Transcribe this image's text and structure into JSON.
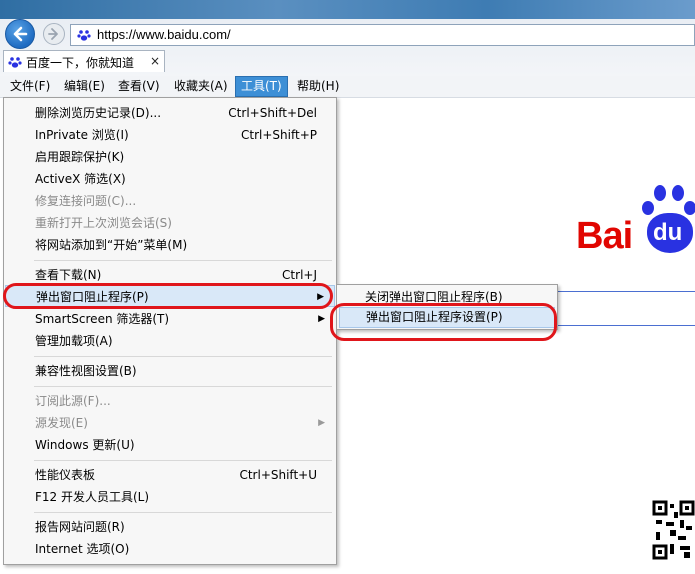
{
  "browser": {
    "url": "https://www.baidu.com/",
    "tab_title": "百度一下，你就知道",
    "tab_close": "×"
  },
  "menubar": [
    {
      "label": "文件(F)"
    },
    {
      "label": "编辑(E)"
    },
    {
      "label": "查看(V)"
    },
    {
      "label": "收藏夹(A)"
    },
    {
      "label": "工具(T)"
    },
    {
      "label": "帮助(H)"
    }
  ],
  "active_menu": "工具(T)",
  "tools_menu": {
    "items": [
      {
        "label": "删除浏览历史记录(D)...",
        "shortcut": "Ctrl+Shift+Del"
      },
      {
        "label": "InPrivate 浏览(I)",
        "shortcut": "Ctrl+Shift+P"
      },
      {
        "label": "启用跟踪保护(K)",
        "shortcut": ""
      },
      {
        "label": "ActiveX 筛选(X)",
        "shortcut": ""
      },
      {
        "label": "修复连接问题(C)...",
        "shortcut": "",
        "disabled": true
      },
      {
        "label": "重新打开上次浏览会话(S)",
        "shortcut": "",
        "disabled": true
      },
      {
        "label": "将网站添加到“开始”菜单(M)",
        "shortcut": ""
      },
      {
        "label": "查看下载(N)",
        "shortcut": "Ctrl+J"
      },
      {
        "label": "弹出窗口阻止程序(P)",
        "shortcut": "",
        "submenu": true
      },
      {
        "label": "SmartScreen 筛选器(T)",
        "shortcut": "",
        "submenu": true
      },
      {
        "label": "管理加载项(A)",
        "shortcut": ""
      },
      {
        "label": "兼容性视图设置(B)",
        "shortcut": ""
      },
      {
        "label": "订阅此源(F)...",
        "shortcut": "",
        "disabled": true
      },
      {
        "label": "源发现(E)",
        "shortcut": "",
        "disabled": true,
        "submenu": true
      },
      {
        "label": "Windows 更新(U)",
        "shortcut": ""
      },
      {
        "label": "性能仪表板",
        "shortcut": "Ctrl+Shift+U"
      },
      {
        "label": "F12 开发人员工具(L)",
        "shortcut": ""
      },
      {
        "label": "报告网站问题(R)",
        "shortcut": ""
      },
      {
        "label": "Internet 选项(O)",
        "shortcut": ""
      }
    ]
  },
  "popup_submenu": {
    "items": [
      {
        "label": "关闭弹出窗口阻止程序(B)"
      },
      {
        "label": "弹出窗口阻止程序设置(P)"
      }
    ]
  },
  "page": {
    "logo_text": "Bai",
    "logo_suffix": "du"
  },
  "colors": {
    "annotation": "#e0161b",
    "menu_highlight": "#d9e8f8",
    "active_menu": "#3d8fd6",
    "baidu_red": "#e10601",
    "baidu_blue": "#2932e1"
  }
}
